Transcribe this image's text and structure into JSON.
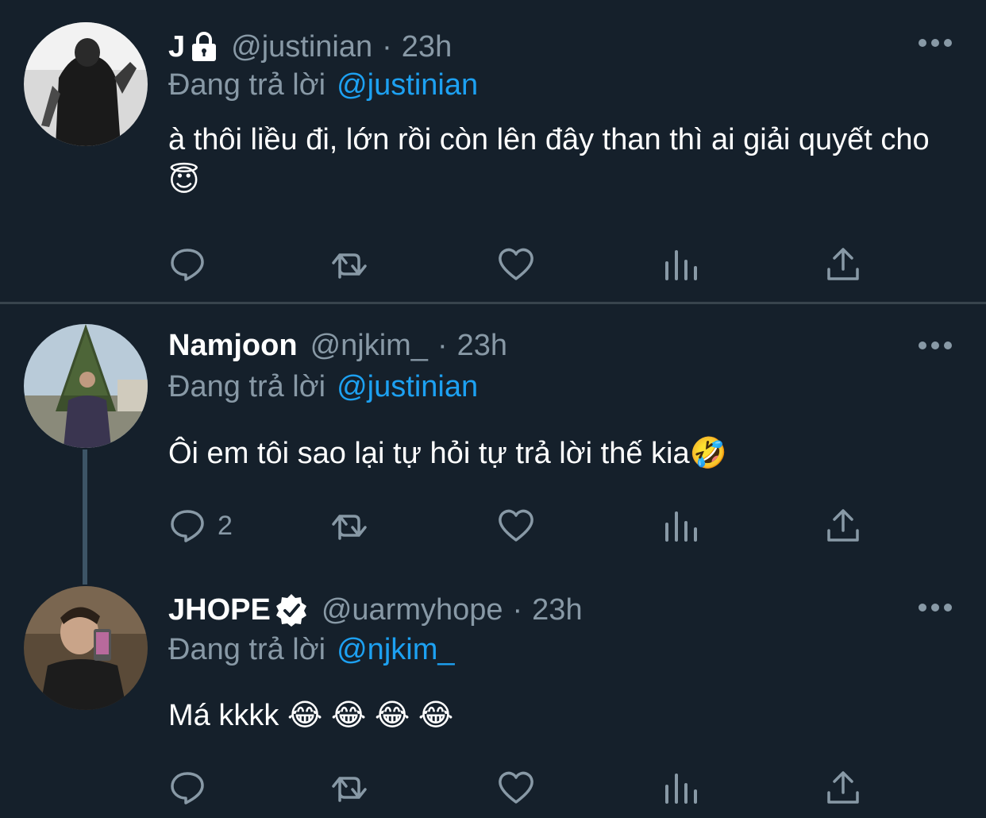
{
  "replying_prefix": "Đang trả lời",
  "tweets": [
    {
      "name": "J",
      "handle": "@justinian",
      "dot": "·",
      "time": "23h",
      "reply_to": "@justinian",
      "text": "à thôi liều đi, lớn rồi còn lên đây than thì ai giải quyết cho😇",
      "protected": true,
      "reply_count": ""
    },
    {
      "name": "Namjoon",
      "handle": "@njkim_",
      "dot": "·",
      "time": "23h",
      "reply_to": "@justinian",
      "text": "Ôi em tôi sao lại tự hỏi tự trả lời thế kia🤣",
      "reply_count": "2"
    },
    {
      "name": "JHOPE",
      "handle": "@uarmyhope",
      "dot": "·",
      "time": "23h",
      "reply_to": "@njkim_",
      "text": "Má kkkk 😂 😂 😂 😂",
      "verified": true,
      "reply_count": ""
    }
  ],
  "icons": {
    "reply": "reply-icon",
    "retweet": "retweet-icon",
    "like": "like-icon",
    "analytics": "analytics-icon",
    "share": "share-icon",
    "more": "more-icon"
  },
  "colors": {
    "background": "#15202b",
    "secondary_text": "#8899a6",
    "link": "#1da1f2",
    "divider": "#38444d"
  }
}
